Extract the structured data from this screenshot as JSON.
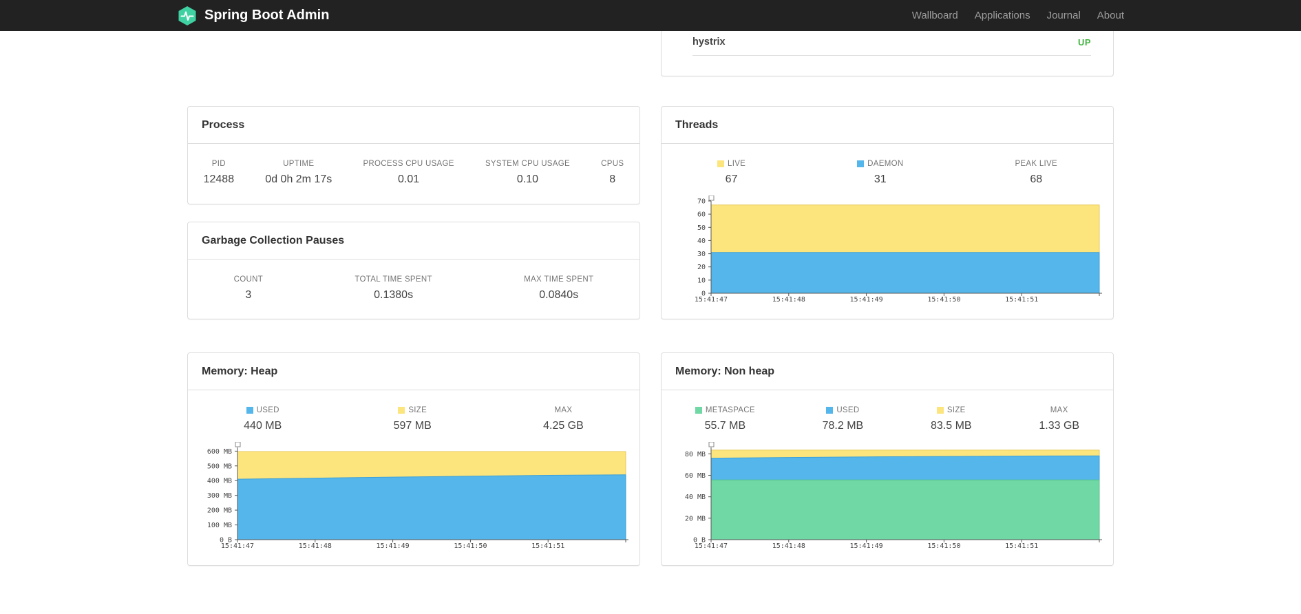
{
  "navbar": {
    "brand": "Spring Boot Admin",
    "logo_color": "#40d1a2",
    "items": [
      {
        "label": "Wallboard"
      },
      {
        "label": "Applications"
      },
      {
        "label": "Journal"
      },
      {
        "label": "About"
      }
    ]
  },
  "status_panel": {
    "app_name": "hystrix",
    "status": "UP",
    "status_color": "#44b543"
  },
  "process_panel": {
    "title": "Process",
    "stats": [
      {
        "label": "PID",
        "value": "12488"
      },
      {
        "label": "UPTIME",
        "value": "0d 0h 2m 17s"
      },
      {
        "label": "PROCESS CPU USAGE",
        "value": "0.01"
      },
      {
        "label": "SYSTEM CPU USAGE",
        "value": "0.10"
      },
      {
        "label": "CPUS",
        "value": "8"
      }
    ]
  },
  "gc_panel": {
    "title": "Garbage Collection Pauses",
    "stats": [
      {
        "label": "COUNT",
        "value": "3"
      },
      {
        "label": "TOTAL TIME SPENT",
        "value": "0.1380s"
      },
      {
        "label": "MAX TIME SPENT",
        "value": "0.0840s"
      }
    ]
  },
  "threads_panel": {
    "title": "Threads",
    "legend": [
      {
        "label": "LIVE",
        "value": "67",
        "color": "#fde57e"
      },
      {
        "label": "DAEMON",
        "value": "31",
        "color": "#54b6ea"
      },
      {
        "label": "PEAK LIVE",
        "value": "68"
      }
    ]
  },
  "heap_panel": {
    "title": "Memory: Heap",
    "legend": [
      {
        "label": "USED",
        "value": "440 MB",
        "color": "#54b6ea"
      },
      {
        "label": "SIZE",
        "value": "597 MB",
        "color": "#fde57e"
      },
      {
        "label": "MAX",
        "value": "4.25 GB"
      }
    ]
  },
  "nonheap_panel": {
    "title": "Memory: Non heap",
    "legend": [
      {
        "label": "METASPACE",
        "value": "55.7 MB",
        "color": "#6fd8a4"
      },
      {
        "label": "USED",
        "value": "78.2 MB",
        "color": "#54b6ea"
      },
      {
        "label": "SIZE",
        "value": "83.5 MB",
        "color": "#fde57e"
      },
      {
        "label": "MAX",
        "value": "1.33 GB"
      }
    ]
  },
  "chart_data": [
    {
      "id": "threads",
      "type": "area",
      "title": "Threads",
      "x_labels": [
        "15:41:47",
        "15:41:48",
        "15:41:49",
        "15:41:50",
        "15:41:51"
      ],
      "points": 6,
      "ylim": [
        0,
        70
      ],
      "grid": false,
      "legend_position": "top",
      "yticks": [
        {
          "v": 0,
          "label": "0"
        },
        {
          "v": 10,
          "label": "10"
        },
        {
          "v": 20,
          "label": "20"
        },
        {
          "v": 30,
          "label": "30"
        },
        {
          "v": 40,
          "label": "40"
        },
        {
          "v": 50,
          "label": "50"
        },
        {
          "v": 60,
          "label": "60"
        },
        {
          "v": 70,
          "label": "70"
        }
      ],
      "series": [
        {
          "name": "LIVE",
          "color": "#fde57e",
          "stroke": "#e8cb5e",
          "values": [
            67,
            67,
            67,
            67,
            67,
            67
          ]
        },
        {
          "name": "DAEMON",
          "color": "#54b6ea",
          "stroke": "#3da0d8",
          "values": [
            31,
            31,
            31,
            31,
            31,
            31
          ]
        }
      ]
    },
    {
      "id": "heap",
      "type": "area",
      "title": "Memory: Heap",
      "x_labels": [
        "15:41:47",
        "15:41:48",
        "15:41:49",
        "15:41:50",
        "15:41:51"
      ],
      "points": 6,
      "ylim": [
        0,
        625
      ],
      "grid": false,
      "legend_position": "top",
      "yticks": [
        {
          "v": 0,
          "label": "0 B"
        },
        {
          "v": 100,
          "label": "100 MB"
        },
        {
          "v": 200,
          "label": "200 MB"
        },
        {
          "v": 300,
          "label": "300 MB"
        },
        {
          "v": 400,
          "label": "400 MB"
        },
        {
          "v": 500,
          "label": "500 MB"
        },
        {
          "v": 600,
          "label": "600 MB"
        }
      ],
      "series": [
        {
          "name": "SIZE",
          "color": "#fde57e",
          "stroke": "#e8cb5e",
          "values": [
            597,
            597,
            597,
            597,
            597,
            597
          ]
        },
        {
          "name": "USED",
          "color": "#54b6ea",
          "stroke": "#3da0d8",
          "values": [
            410,
            417,
            424,
            430,
            436,
            440
          ]
        }
      ]
    },
    {
      "id": "nonheap",
      "type": "area",
      "title": "Memory: Non heap",
      "x_labels": [
        "15:41:47",
        "15:41:48",
        "15:41:49",
        "15:41:50",
        "15:41:51"
      ],
      "points": 6,
      "ylim": [
        0,
        86
      ],
      "grid": false,
      "legend_position": "top",
      "yticks": [
        {
          "v": 0,
          "label": "0 B"
        },
        {
          "v": 20,
          "label": "20 MB"
        },
        {
          "v": 40,
          "label": "40 MB"
        },
        {
          "v": 60,
          "label": "60 MB"
        },
        {
          "v": 80,
          "label": "80 MB"
        }
      ],
      "series": [
        {
          "name": "SIZE",
          "color": "#fde57e",
          "stroke": "#e8cb5e",
          "values": [
            83.5,
            83.5,
            83.5,
            83.5,
            83.5,
            83.5
          ]
        },
        {
          "name": "USED",
          "color": "#54b6ea",
          "stroke": "#3da0d8",
          "values": [
            76.0,
            76.6,
            77.2,
            77.6,
            78.0,
            78.2
          ]
        },
        {
          "name": "METASPACE",
          "color": "#6fd8a4",
          "stroke": "#55c28b",
          "values": [
            55.7,
            55.7,
            55.7,
            55.7,
            55.7,
            55.7
          ]
        }
      ]
    }
  ]
}
